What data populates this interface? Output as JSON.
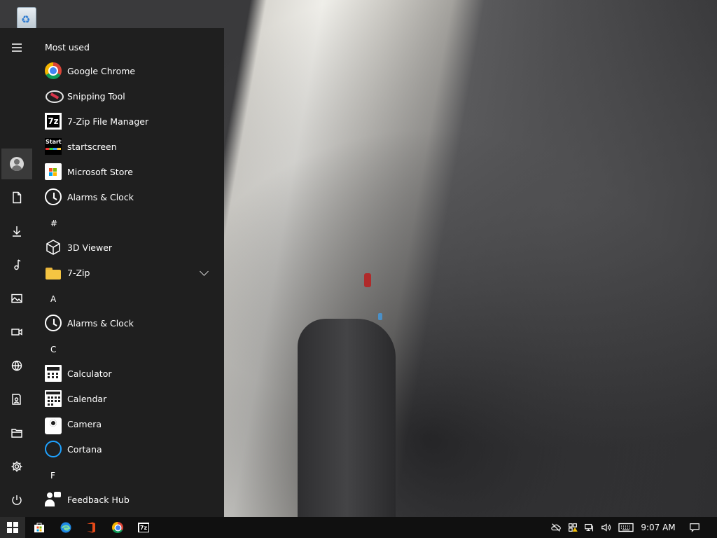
{
  "desktop": {
    "recycle_bin_icon": "recycle-bin-icon"
  },
  "start_menu": {
    "rail": [
      {
        "name": "menu-icon"
      },
      {
        "name": "user-avatar-icon"
      },
      {
        "name": "documents-icon"
      },
      {
        "name": "downloads-icon"
      },
      {
        "name": "music-icon"
      },
      {
        "name": "pictures-icon"
      },
      {
        "name": "videos-icon"
      },
      {
        "name": "network-icon"
      },
      {
        "name": "personal-folder-icon"
      },
      {
        "name": "file-explorer-icon"
      },
      {
        "name": "settings-icon"
      },
      {
        "name": "power-icon"
      }
    ],
    "most_used_header": "Most used",
    "most_used": [
      {
        "label": "Google Chrome",
        "icon": "chrome-icon"
      },
      {
        "label": "Snipping Tool",
        "icon": "snipping-tool-icon"
      },
      {
        "label": "7-Zip File Manager",
        "icon": "7zip-icon"
      },
      {
        "label": "startscreen",
        "icon": "startscreen-icon"
      },
      {
        "label": "Microsoft Store",
        "icon": "microsoft-store-icon"
      },
      {
        "label": "Alarms & Clock",
        "icon": "alarm-clock-icon"
      }
    ],
    "groups": {
      "hash": {
        "letter": "#",
        "items": [
          {
            "label": "3D Viewer",
            "icon": "3d-viewer-icon"
          },
          {
            "label": "7-Zip",
            "icon": "folder-icon"
          }
        ]
      },
      "a": {
        "letter": "A",
        "items": [
          {
            "label": "Alarms & Clock",
            "icon": "alarm-clock-icon"
          }
        ]
      },
      "c": {
        "letter": "C",
        "items": [
          {
            "label": "Calculator",
            "icon": "calculator-icon"
          },
          {
            "label": "Calendar",
            "icon": "calendar-icon"
          },
          {
            "label": "Camera",
            "icon": "camera-icon"
          },
          {
            "label": "Cortana",
            "icon": "cortana-icon"
          }
        ]
      },
      "f": {
        "letter": "F",
        "items": [
          {
            "label": "Feedback Hub",
            "icon": "feedback-hub-icon"
          }
        ]
      }
    }
  },
  "taskbar": {
    "pinned": [
      {
        "name": "start-icon"
      },
      {
        "name": "microsoft-store-icon"
      },
      {
        "name": "edge-icon"
      },
      {
        "name": "office-icon"
      },
      {
        "name": "chrome-icon"
      },
      {
        "name": "7zip-icon"
      }
    ],
    "tray": [
      {
        "name": "onedrive-offline-icon"
      },
      {
        "name": "windows-security-icon"
      },
      {
        "name": "network-icon"
      },
      {
        "name": "volume-icon"
      },
      {
        "name": "keyboard-icon"
      }
    ],
    "clock": "9:07 AM",
    "notifications_icon": "action-center-icon"
  },
  "colors": {
    "menu_bg": "#1f1f1f",
    "taskbar_bg": "#101010",
    "selected_rail": "#3a3a3a",
    "text": "#ffffff",
    "cortana_blue": "#1fa2ff"
  }
}
